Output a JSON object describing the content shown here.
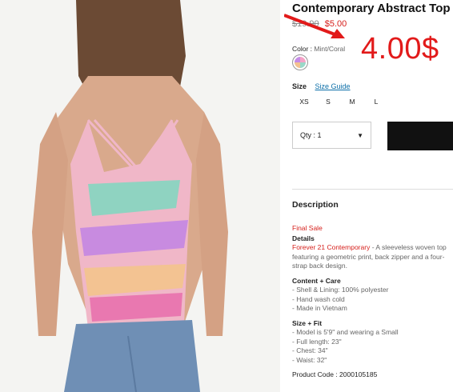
{
  "product": {
    "title": "Contemporary Abstract Top",
    "price_old": "$19.90",
    "price_new": "$5.00",
    "promo_price": "4.00$",
    "color_label": "Color",
    "color_value": "Mint/Coral",
    "size_label": "Size",
    "size_guide": "Size Guide",
    "sizes": [
      "XS",
      "S",
      "M",
      "L"
    ],
    "qty_label": "Qty : 1"
  },
  "description": {
    "heading": "Description",
    "final_sale": "Final Sale",
    "details_heading": "Details",
    "details_brand": "Forever 21 Contemporary",
    "details_text": " - A sleeveless woven top featuring a geometric print, back zipper and a four-strap back design.",
    "care_heading": "Content + Care",
    "care_items": [
      "- Shell & Lining: 100% polyester",
      "- Hand wash cold",
      "- Made in Vietnam"
    ],
    "fit_heading": "Size + Fit",
    "fit_items": [
      "- Model is 5'9\" and wearing a Small",
      "- Full length: 23\"",
      "- Chest: 34\"",
      "- Waist: 32\""
    ],
    "product_code": "Product Code : 2000105185"
  },
  "colors": {
    "accent_red": "#d6201c",
    "promo_red": "#e21a1a",
    "link_blue": "#0b6ea8"
  }
}
